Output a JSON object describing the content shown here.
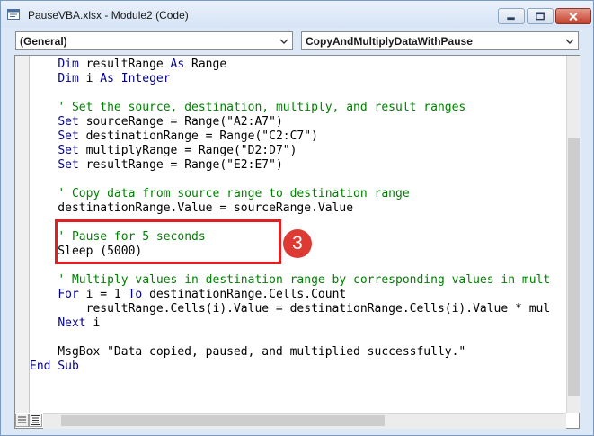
{
  "window": {
    "title": "PauseVBA.xlsx - Module2 (Code)",
    "icon": "vba-module-icon",
    "controls": [
      "minimize-icon",
      "maximize-icon",
      "close-icon"
    ]
  },
  "toolbar": {
    "object_combo": "(General)",
    "procedure_combo": "CopyAndMultiplyDataWithPause"
  },
  "code": {
    "lines": [
      {
        "tokens": [
          {
            "t": "    "
          },
          {
            "t": "Dim",
            "c": "kw"
          },
          {
            "t": " resultRange "
          },
          {
            "t": "As",
            "c": "kw"
          },
          {
            "t": " Range"
          }
        ]
      },
      {
        "tokens": [
          {
            "t": "    "
          },
          {
            "t": "Dim",
            "c": "kw"
          },
          {
            "t": " i "
          },
          {
            "t": "As",
            "c": "kw"
          },
          {
            "t": " "
          },
          {
            "t": "Integer",
            "c": "kw"
          }
        ]
      },
      {
        "tokens": []
      },
      {
        "tokens": [
          {
            "t": "    "
          },
          {
            "t": "' Set the source, destination, multiply, and result ranges",
            "c": "cm"
          }
        ]
      },
      {
        "tokens": [
          {
            "t": "    "
          },
          {
            "t": "Set",
            "c": "kw"
          },
          {
            "t": " sourceRange = Range(\"A2:A7\")"
          }
        ]
      },
      {
        "tokens": [
          {
            "t": "    "
          },
          {
            "t": "Set",
            "c": "kw"
          },
          {
            "t": " destinationRange = Range(\"C2:C7\")"
          }
        ]
      },
      {
        "tokens": [
          {
            "t": "    "
          },
          {
            "t": "Set",
            "c": "kw"
          },
          {
            "t": " multiplyRange = Range(\"D2:D7\")"
          }
        ]
      },
      {
        "tokens": [
          {
            "t": "    "
          },
          {
            "t": "Set",
            "c": "kw"
          },
          {
            "t": " resultRange = Range(\"E2:E7\")"
          }
        ]
      },
      {
        "tokens": []
      },
      {
        "tokens": [
          {
            "t": "    "
          },
          {
            "t": "' Copy data from source range to destination range",
            "c": "cm"
          }
        ]
      },
      {
        "tokens": [
          {
            "t": "    destinationRange.Value = sourceRange.Value"
          }
        ]
      },
      {
        "tokens": []
      },
      {
        "tokens": [
          {
            "t": "    "
          },
          {
            "t": "' Pause for 5 seconds",
            "c": "cm"
          }
        ]
      },
      {
        "tokens": [
          {
            "t": "    Sleep (5000)"
          }
        ]
      },
      {
        "tokens": []
      },
      {
        "tokens": [
          {
            "t": "    "
          },
          {
            "t": "' Multiply values in destination range by corresponding values in mult",
            "c": "cm"
          }
        ]
      },
      {
        "tokens": [
          {
            "t": "    "
          },
          {
            "t": "For",
            "c": "kw"
          },
          {
            "t": " i = 1 "
          },
          {
            "t": "To",
            "c": "kw"
          },
          {
            "t": " destinationRange.Cells.Count"
          }
        ]
      },
      {
        "tokens": [
          {
            "t": "        resultRange.Cells(i).Value = destinationRange.Cells(i).Value * mul"
          }
        ]
      },
      {
        "tokens": [
          {
            "t": "    "
          },
          {
            "t": "Next",
            "c": "kw"
          },
          {
            "t": " i"
          }
        ]
      },
      {
        "tokens": []
      },
      {
        "tokens": [
          {
            "t": "    MsgBox \"Data copied, paused, and multiplied successfully.\""
          }
        ]
      },
      {
        "tokens": [
          {
            "t": "End Sub",
            "c": "kw"
          }
        ]
      }
    ]
  },
  "annotation": {
    "step_number": "3",
    "color": "#dd3a33"
  },
  "colors": {
    "keyword": "#00008b",
    "comment": "#008000",
    "text": "#000000"
  }
}
